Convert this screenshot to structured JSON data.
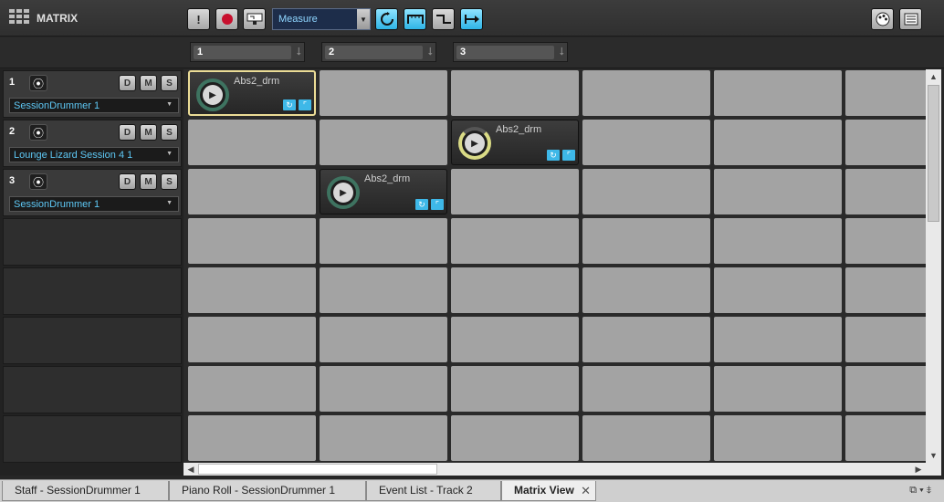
{
  "app": {
    "title": "MATRIX"
  },
  "toolbar": {
    "alert_label": "!",
    "quantize": {
      "selected": "Measure"
    }
  },
  "scenes": [
    {
      "number": "1"
    },
    {
      "number": "2"
    },
    {
      "number": "3"
    }
  ],
  "tracks": [
    {
      "number": "1",
      "device": "SessionDrummer 1",
      "d": "D",
      "m": "M",
      "s": "S"
    },
    {
      "number": "2",
      "device": "Lounge Lizard Session 4 1",
      "d": "D",
      "m": "M",
      "s": "S"
    },
    {
      "number": "3",
      "device": "SessionDrummer 1",
      "d": "D",
      "m": "M",
      "s": "S"
    }
  ],
  "clips": [
    {
      "row": 0,
      "col": 0,
      "name": "Abs2_drm",
      "selected": true,
      "ring": "green"
    },
    {
      "row": 1,
      "col": 2,
      "name": "Abs2_drm",
      "selected": false,
      "ring": "yellow"
    },
    {
      "row": 2,
      "col": 1,
      "name": "Abs2_drm",
      "selected": false,
      "ring": "green"
    }
  ],
  "tabs": [
    {
      "label": "Staff - SessionDrummer 1"
    },
    {
      "label": "Piano Roll - SessionDrummer 1"
    },
    {
      "label": "Event List - Track 2"
    },
    {
      "label": "Matrix View",
      "active": true
    }
  ],
  "colors": {
    "accent": "#3eb8e8",
    "record": "#c8102e",
    "device_text": "#5ec8f5",
    "cell": "#a3a3a3"
  }
}
